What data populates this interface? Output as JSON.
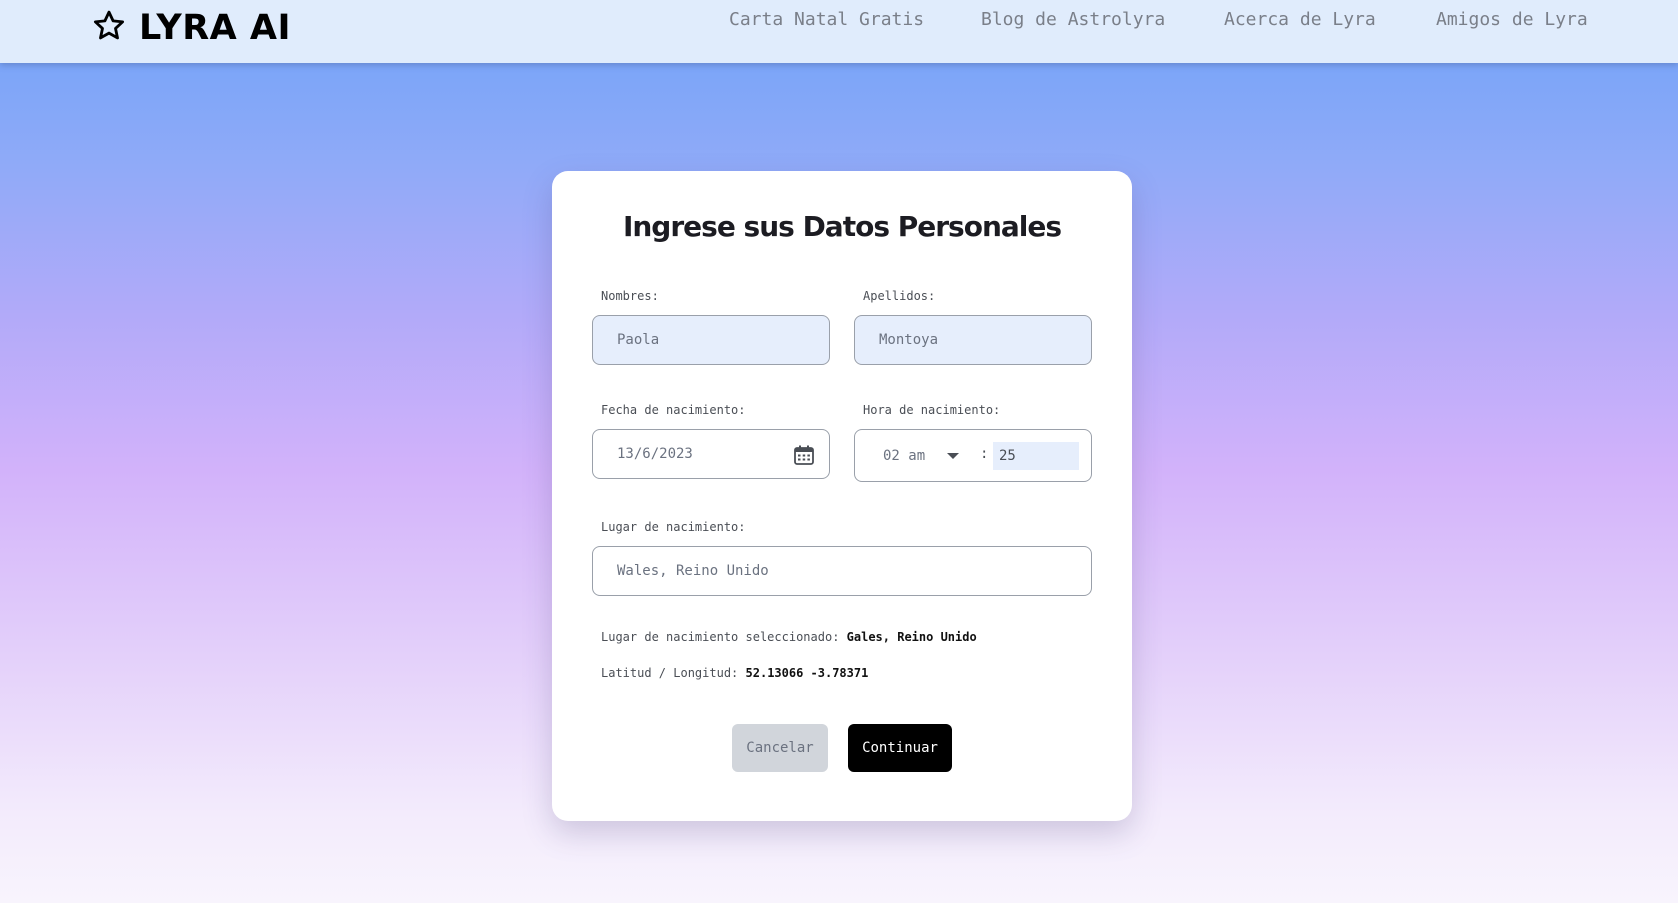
{
  "brand": {
    "name": "LYRA AI",
    "icon": "star-outline-icon"
  },
  "nav": [
    {
      "label": "Carta Natal Gratis"
    },
    {
      "label": "Blog de Astrolyra"
    },
    {
      "label": "Acerca de Lyra"
    },
    {
      "label": "Amigos de Lyra"
    }
  ],
  "form": {
    "title": "Ingrese sus Datos Personales",
    "nombres": {
      "label": "Nombres:",
      "value": "Paola"
    },
    "apellidos": {
      "label": "Apellidos:",
      "value": "Montoya"
    },
    "fecha": {
      "label": "Fecha de nacimiento:",
      "value": "13/6/2023",
      "icon": "calendar-icon"
    },
    "hora": {
      "label": "Hora de nacimiento:",
      "hour": "02 am",
      "separator": ":",
      "minute": "25"
    },
    "lugar": {
      "label": "Lugar de nacimiento:",
      "placeholder": "Wales, Reino Unido"
    },
    "selected_place": {
      "label": "Lugar de nacimiento seleccionado:",
      "value": "Gales, Reino Unido"
    },
    "coords": {
      "label": "Latitud / Longitud:",
      "value": "52.13066 -3.78371"
    },
    "cancel_label": "Cancelar",
    "continue_label": "Continuar"
  },
  "colors": {
    "topbar": "#e0ecfc",
    "field_fill": "#e6eefc",
    "continue_button": "#000000",
    "cancel_button": "#d1d5db"
  }
}
